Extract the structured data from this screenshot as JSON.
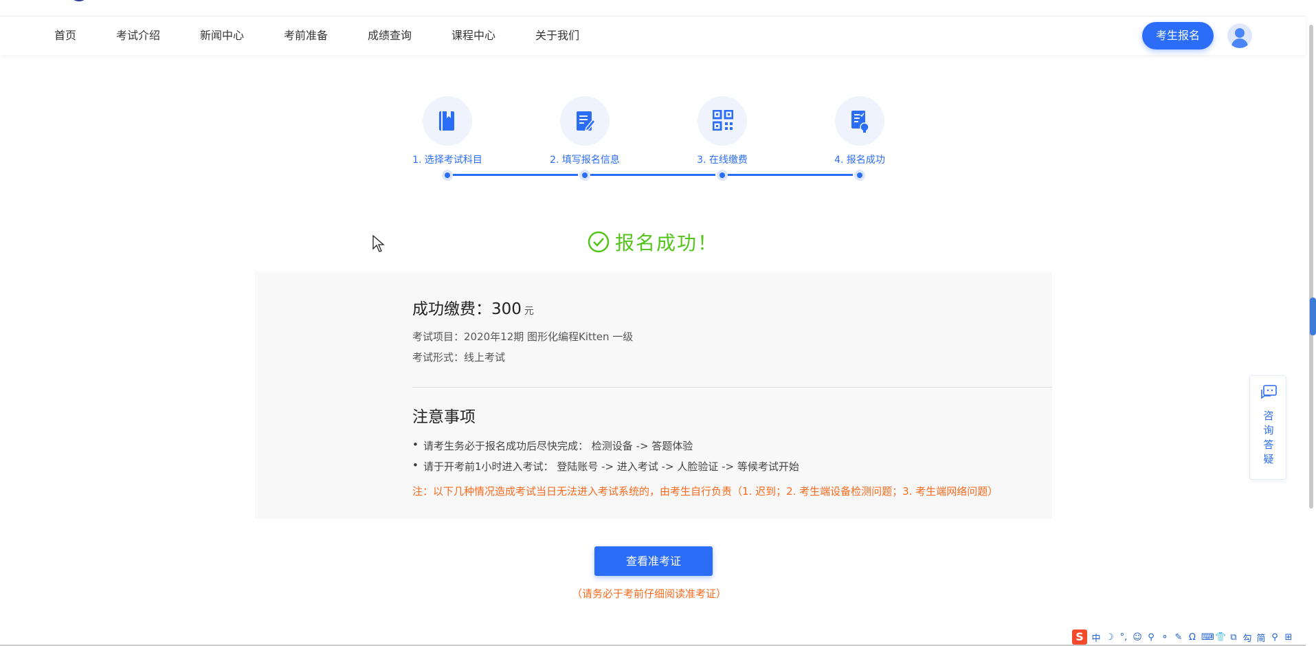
{
  "nav": {
    "items": [
      "首页",
      "考试介绍",
      "新闻中心",
      "考前准备",
      "成绩查询",
      "课程中心",
      "关于我们"
    ],
    "register_label": "考生报名"
  },
  "steps": [
    {
      "label": "1. 选择考试科目",
      "icon": "book-icon"
    },
    {
      "label": "2. 填写报名信息",
      "icon": "edit-form-icon"
    },
    {
      "label": "3. 在线缴费",
      "icon": "qrcode-icon"
    },
    {
      "label": "4. 报名成功",
      "icon": "document-check-icon"
    }
  ],
  "success": {
    "text": "报名成功！"
  },
  "payment": {
    "label": "成功缴费：",
    "amount": "300",
    "unit": "元",
    "exam_item": "考试项目：2020年12期 图形化编程Kitten 一级",
    "exam_form": "考试形式：线上考试"
  },
  "notice": {
    "title": "注意事项",
    "items": [
      "请考生务必于报名成功后尽快完成： 检测设备 -> 答题体验",
      "请于开考前1小时进入考试： 登陆账号 -> 进入考试 -> 人脸验证 -> 等候考试开始"
    ],
    "warning": "注：以下几种情况造成考试当日无法进入考试系统的，由考生自行负责（1. 迟到；2. 考生端设备检测问题；3. 考生端网络问题）"
  },
  "actions": {
    "view_ticket_label": "查看准考证",
    "view_ticket_note": "（请务必于考前仔细阅读准考证）"
  },
  "consult": {
    "label_chars": [
      "咨",
      "询",
      "答",
      "疑"
    ]
  },
  "ime": {
    "glyphs": [
      "中",
      "☽",
      "°,",
      "☺",
      "⚲",
      "⚬",
      "✎",
      "Ω",
      "⌨",
      "👕",
      "⧉",
      "勾",
      "简",
      "⚲",
      "⊞"
    ]
  },
  "colors": {
    "primary": "#2b6df7",
    "success": "#52c41a",
    "warning": "#fa6a1e"
  }
}
